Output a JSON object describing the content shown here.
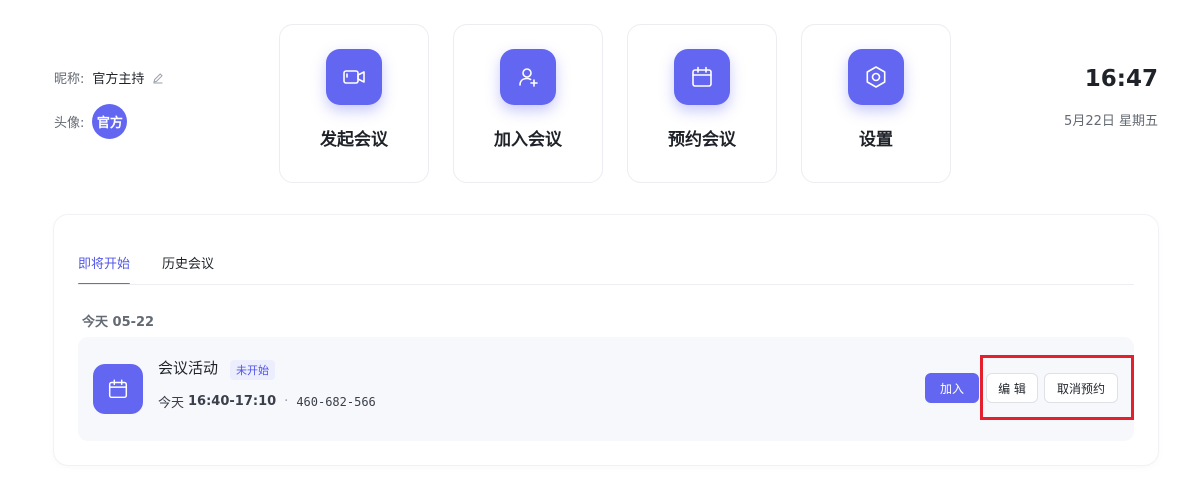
{
  "profile": {
    "nickname_label": "昵称:",
    "nickname_value": "官方主持",
    "avatar_label": "头像:",
    "avatar_text": "官方"
  },
  "actions": [
    {
      "label": "发起会议",
      "icon": "video-camera-icon"
    },
    {
      "label": "加入会议",
      "icon": "user-plus-icon"
    },
    {
      "label": "预约会议",
      "icon": "calendar-icon"
    },
    {
      "label": "设置",
      "icon": "gear-icon"
    }
  ],
  "clock": {
    "time": "16:47",
    "date": "5月22日 星期五"
  },
  "tabs": [
    {
      "label": "即将开始",
      "active": true
    },
    {
      "label": "历史会议",
      "active": false
    }
  ],
  "meetings": {
    "date_heading": "今天 05-22",
    "items": [
      {
        "title": "会议活动",
        "status": "未开始",
        "day": "今天",
        "time": "16:40-17:10",
        "separator": "·",
        "meeting_id": "460-682-566",
        "join_label": "加入",
        "edit_label": "编 辑",
        "cancel_label": "取消预约"
      }
    ]
  },
  "colors": {
    "accent": "#6366f1",
    "highlight": "#e5202e"
  }
}
